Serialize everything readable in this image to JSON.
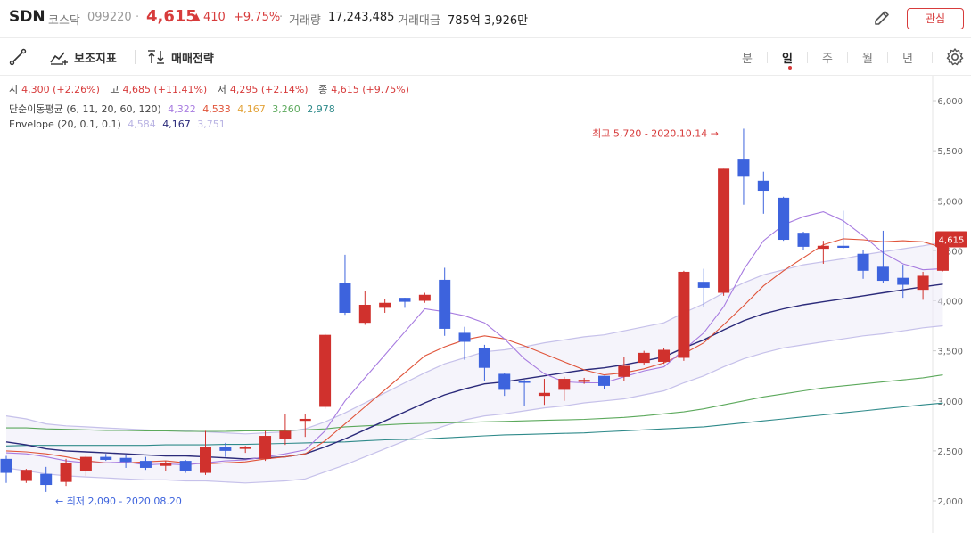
{
  "header": {
    "symbol": "SDN",
    "market": "코스닥",
    "code": "099220",
    "separator": "·",
    "price": "4,615",
    "change_arrow": "▲",
    "change": "410",
    "change_pct": "+9.75%",
    "volume_label": "거래량",
    "volume_value": "17,243,485",
    "amount_label": "거래대금",
    "amount_value": "785억 3,926만",
    "favorite_label": "관심"
  },
  "toolbar": {
    "draw_tool_icon": "line-draw-icon",
    "indicator_label": "보조지표",
    "strategy_label": "매매전략",
    "periods": [
      "분",
      "일",
      "주",
      "월",
      "년"
    ],
    "active_period": "일"
  },
  "ohlc": {
    "open_label": "시",
    "open": "4,300 (+2.26%)",
    "high_label": "고",
    "high": "4,685 (+11.41%)",
    "low_label": "저",
    "low": "4,295 (+2.14%)",
    "close_label": "종",
    "close": "4,615 (+9.75%)"
  },
  "ma": {
    "label": "단순이동평균 (6, 11, 20, 60, 120)",
    "values": [
      "4,322",
      "4,533",
      "4,167",
      "3,260",
      "2,978"
    ],
    "colors": [
      "#a77be0",
      "#e0543a",
      "#e3a33a",
      "#5ca95c",
      "#2f8a8a"
    ]
  },
  "envelope": {
    "label": "Envelope (20, 0.1, 0.1)",
    "values": [
      "4,584",
      "4,167",
      "3,751"
    ],
    "colors": [
      "#b9b3e3",
      "#2b2a7a",
      "#b9b3e3"
    ]
  },
  "annotations": {
    "high": "최고 5,720 - 2020.10.14 →",
    "low": "← 최저 2,090 - 2020.08.20"
  },
  "colors": {
    "up": "#d0312d",
    "down": "#3d63dd",
    "accent": "#d73b3b"
  },
  "chart_data": {
    "type": "candlestick",
    "ylim": [
      1800,
      6150
    ],
    "y_ticks": [
      2000,
      2500,
      3000,
      3500,
      4000,
      4500,
      5000,
      5500,
      6000
    ],
    "y_tick_labels": [
      "2,000",
      "2,500",
      "3,000",
      "3,500",
      "4,000",
      "4,500",
      "5,000",
      "5,500",
      "6,000"
    ],
    "last_price_label": "4,615",
    "candles": [
      {
        "o": 2420,
        "h": 2450,
        "l": 2180,
        "c": 2280
      },
      {
        "o": 2200,
        "h": 2320,
        "l": 2180,
        "c": 2310
      },
      {
        "o": 2270,
        "h": 2340,
        "l": 2090,
        "c": 2160
      },
      {
        "o": 2190,
        "h": 2420,
        "l": 2150,
        "c": 2380
      },
      {
        "o": 2300,
        "h": 2450,
        "l": 2250,
        "c": 2440
      },
      {
        "o": 2440,
        "h": 2470,
        "l": 2400,
        "c": 2410
      },
      {
        "o": 2430,
        "h": 2460,
        "l": 2330,
        "c": 2390
      },
      {
        "o": 2400,
        "h": 2440,
        "l": 2310,
        "c": 2330
      },
      {
        "o": 2350,
        "h": 2400,
        "l": 2300,
        "c": 2380
      },
      {
        "o": 2400,
        "h": 2410,
        "l": 2280,
        "c": 2300
      },
      {
        "o": 2280,
        "h": 2700,
        "l": 2260,
        "c": 2540
      },
      {
        "o": 2540,
        "h": 2580,
        "l": 2440,
        "c": 2500
      },
      {
        "o": 2520,
        "h": 2550,
        "l": 2480,
        "c": 2540
      },
      {
        "o": 2420,
        "h": 2700,
        "l": 2400,
        "c": 2650
      },
      {
        "o": 2620,
        "h": 2870,
        "l": 2560,
        "c": 2700
      },
      {
        "o": 2800,
        "h": 2870,
        "l": 2640,
        "c": 2820
      },
      {
        "o": 2940,
        "h": 3670,
        "l": 2920,
        "c": 3660
      },
      {
        "o": 4180,
        "h": 4460,
        "l": 3860,
        "c": 3880
      },
      {
        "o": 3780,
        "h": 4100,
        "l": 3760,
        "c": 3960
      },
      {
        "o": 3930,
        "h": 4020,
        "l": 3880,
        "c": 3980
      },
      {
        "o": 4030,
        "h": 4030,
        "l": 3930,
        "c": 3990
      },
      {
        "o": 4000,
        "h": 4080,
        "l": 3980,
        "c": 4060
      },
      {
        "o": 4210,
        "h": 4330,
        "l": 3650,
        "c": 3720
      },
      {
        "o": 3680,
        "h": 3740,
        "l": 3410,
        "c": 3590
      },
      {
        "o": 3530,
        "h": 3560,
        "l": 3200,
        "c": 3330
      },
      {
        "o": 3270,
        "h": 3280,
        "l": 3050,
        "c": 3110
      },
      {
        "o": 3200,
        "h": 3210,
        "l": 2950,
        "c": 3180
      },
      {
        "o": 3050,
        "h": 3220,
        "l": 2960,
        "c": 3080
      },
      {
        "o": 3110,
        "h": 3240,
        "l": 3000,
        "c": 3220
      },
      {
        "o": 3190,
        "h": 3230,
        "l": 3170,
        "c": 3210
      },
      {
        "o": 3250,
        "h": 3250,
        "l": 3120,
        "c": 3150
      },
      {
        "o": 3240,
        "h": 3440,
        "l": 3200,
        "c": 3350
      },
      {
        "o": 3380,
        "h": 3500,
        "l": 3360,
        "c": 3480
      },
      {
        "o": 3390,
        "h": 3530,
        "l": 3370,
        "c": 3510
      },
      {
        "o": 3430,
        "h": 4300,
        "l": 3400,
        "c": 4290
      },
      {
        "o": 4190,
        "h": 4320,
        "l": 3940,
        "c": 4130
      },
      {
        "o": 4080,
        "h": 5320,
        "l": 4050,
        "c": 5320
      },
      {
        "o": 5420,
        "h": 5720,
        "l": 4960,
        "c": 5240
      },
      {
        "o": 5200,
        "h": 5290,
        "l": 4870,
        "c": 5100
      },
      {
        "o": 5030,
        "h": 5040,
        "l": 4600,
        "c": 4610
      },
      {
        "o": 4680,
        "h": 4690,
        "l": 4510,
        "c": 4540
      },
      {
        "o": 4520,
        "h": 4600,
        "l": 4370,
        "c": 4550
      },
      {
        "o": 4550,
        "h": 4900,
        "l": 4520,
        "c": 4530
      },
      {
        "o": 4470,
        "h": 4510,
        "l": 4220,
        "c": 4300
      },
      {
        "o": 4340,
        "h": 4700,
        "l": 4180,
        "c": 4200
      },
      {
        "o": 4230,
        "h": 4360,
        "l": 4030,
        "c": 4160
      },
      {
        "o": 4110,
        "h": 4290,
        "l": 4010,
        "c": 4250
      },
      {
        "o": 4300,
        "h": 4685,
        "l": 4295,
        "c": 4615
      }
    ],
    "series": [
      {
        "name": "6",
        "values": [
          2480,
          2470,
          2440,
          2400,
          2380,
          2380,
          2390,
          2360,
          2370,
          2360,
          2380,
          2400,
          2410,
          2440,
          2470,
          2510,
          2700,
          3000,
          3230,
          3460,
          3690,
          3920,
          3890,
          3850,
          3780,
          3620,
          3420,
          3270,
          3190,
          3180,
          3180,
          3240,
          3300,
          3340,
          3510,
          3680,
          3940,
          4310,
          4600,
          4760,
          4840,
          4890,
          4800,
          4650,
          4480,
          4370,
          4310,
          4322
        ]
      },
      {
        "name": "11",
        "values": [
          2500,
          2490,
          2470,
          2440,
          2400,
          2380,
          2380,
          2390,
          2400,
          2380,
          2370,
          2380,
          2390,
          2420,
          2440,
          2470,
          2600,
          2770,
          2940,
          3110,
          3280,
          3450,
          3540,
          3610,
          3650,
          3620,
          3550,
          3470,
          3390,
          3310,
          3260,
          3280,
          3320,
          3380,
          3470,
          3580,
          3760,
          3950,
          4150,
          4300,
          4430,
          4560,
          4620,
          4610,
          4590,
          4600,
          4590,
          4533
        ]
      },
      {
        "name": "20",
        "values": [
          2590,
          2560,
          2520,
          2500,
          2490,
          2480,
          2470,
          2460,
          2450,
          2450,
          2440,
          2430,
          2420,
          2430,
          2440,
          2470,
          2540,
          2620,
          2710,
          2800,
          2890,
          2980,
          3060,
          3120,
          3170,
          3190,
          3220,
          3250,
          3280,
          3310,
          3330,
          3360,
          3400,
          3440,
          3530,
          3610,
          3710,
          3800,
          3870,
          3920,
          3960,
          3990,
          4020,
          4050,
          4080,
          4110,
          4140,
          4167
        ]
      },
      {
        "name": "60",
        "values": [
          2730,
          2730,
          2720,
          2715,
          2710,
          2705,
          2705,
          2700,
          2700,
          2695,
          2695,
          2695,
          2700,
          2700,
          2705,
          2710,
          2720,
          2740,
          2750,
          2760,
          2770,
          2775,
          2780,
          2785,
          2790,
          2795,
          2800,
          2805,
          2810,
          2815,
          2825,
          2835,
          2850,
          2870,
          2890,
          2920,
          2960,
          3000,
          3040,
          3070,
          3100,
          3130,
          3150,
          3170,
          3190,
          3210,
          3230,
          3260
        ]
      },
      {
        "name": "120",
        "values": [
          2550,
          2555,
          2555,
          2555,
          2555,
          2555,
          2555,
          2555,
          2560,
          2560,
          2560,
          2565,
          2565,
          2570,
          2575,
          2580,
          2585,
          2590,
          2600,
          2610,
          2615,
          2620,
          2630,
          2640,
          2650,
          2660,
          2665,
          2670,
          2675,
          2680,
          2690,
          2700,
          2710,
          2720,
          2730,
          2740,
          2760,
          2780,
          2800,
          2820,
          2840,
          2860,
          2880,
          2900,
          2920,
          2940,
          2960,
          2978
        ]
      },
      {
        "name": "env-upper",
        "values": [
          2850,
          2820,
          2770,
          2750,
          2740,
          2730,
          2720,
          2710,
          2700,
          2700,
          2690,
          2680,
          2670,
          2680,
          2690,
          2720,
          2790,
          2880,
          2980,
          3080,
          3180,
          3280,
          3370,
          3430,
          3490,
          3510,
          3540,
          3580,
          3610,
          3640,
          3660,
          3700,
          3740,
          3780,
          3880,
          3970,
          4080,
          4180,
          4260,
          4310,
          4360,
          4390,
          4420,
          4460,
          4490,
          4520,
          4550,
          4584
        ]
      },
      {
        "name": "env-lower",
        "values": [
          2330,
          2300,
          2270,
          2250,
          2240,
          2230,
          2220,
          2210,
          2210,
          2200,
          2200,
          2190,
          2180,
          2190,
          2200,
          2220,
          2290,
          2360,
          2440,
          2520,
          2600,
          2680,
          2750,
          2810,
          2850,
          2870,
          2900,
          2930,
          2950,
          2980,
          3000,
          3020,
          3060,
          3100,
          3180,
          3250,
          3340,
          3420,
          3480,
          3530,
          3560,
          3590,
          3620,
          3650,
          3670,
          3700,
          3730,
          3751
        ]
      }
    ]
  }
}
